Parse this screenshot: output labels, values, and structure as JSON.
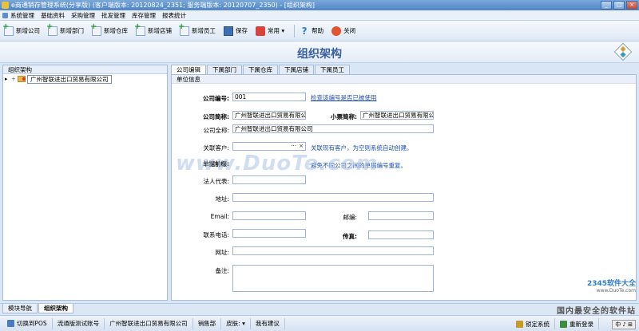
{
  "window": {
    "title": "e商通销存管理系统(分享版) (客户端版本: 20120824_2351; 服务端版本: 20120707_2350) - [组织架构]",
    "controls": [
      "_",
      "□",
      "×"
    ]
  },
  "menubar": {
    "items": [
      "系统管理",
      "基础资料",
      "采购管理",
      "批发管理",
      "库存管理",
      "报表统计"
    ]
  },
  "toolbar": {
    "add_company": "新增公司",
    "add_department": "新增部门",
    "add_warehouse": "新增仓库",
    "add_store": "新增店铺",
    "add_employee": "新增员工",
    "save": "保存",
    "common": "常用",
    "help": "帮助",
    "close": "关闭"
  },
  "page": {
    "title": "组织架构"
  },
  "tree": {
    "header": "组织架构",
    "root_label": "广州智联进出口贸易有限公司",
    "arrow": "▸",
    "expander": "+"
  },
  "tabs": [
    "公司编辑",
    "下属部门",
    "下属仓库",
    "下属店铺",
    "下属员工"
  ],
  "form": {
    "group_title": "单位信息",
    "company_code_label": "公司编号:",
    "company_code_value": "001",
    "check_link": "检查该编号是否已被使用",
    "short_name_label": "公司简称:",
    "short_name_value": "广州智联进出口贸易有限公司",
    "ticket_name_label": "小票简称:",
    "ticket_name_value": "广州智联进出口贸易有限公司",
    "full_name_label": "公司全称:",
    "full_name_value": "广州智联进出口贸易有限公司",
    "related_customer_label": "关联客户:",
    "related_customer_dots": "···",
    "related_customer_clear": "×",
    "related_customer_note": "关联现有客户，为空则系统自动创建。",
    "doc_prefix_label": "单据前缀:",
    "doc_prefix_note": "避免不同公司之间的单据编号重复。",
    "legal_rep_label": "法人代表:",
    "address_label": "地址:",
    "email_label": "Email:",
    "postcode_label": "邮编:",
    "phone_label": "联系电话:",
    "fax_label": "传真:",
    "website_label": "网址:",
    "remarks_label": "备注:"
  },
  "watermark": "www.DuoTe.com",
  "bottom_tabs": [
    "模块导航",
    "组织架构"
  ],
  "statusbar": {
    "switch_pos": "切换到POS",
    "account": "流通版测试账号",
    "company": "广州智联进出口贸易有限公司",
    "dept": "销售部",
    "skin": "皮肤:",
    "feedback": "我有建议",
    "lock": "锁定系统",
    "relogin": "重新登录"
  },
  "overlay": {
    "site_name": "2345软件大全",
    "site_url": "www.DuoTe.com",
    "slogan": "国内最安全的软件站",
    "ime": "中 ♪ ⊞"
  }
}
